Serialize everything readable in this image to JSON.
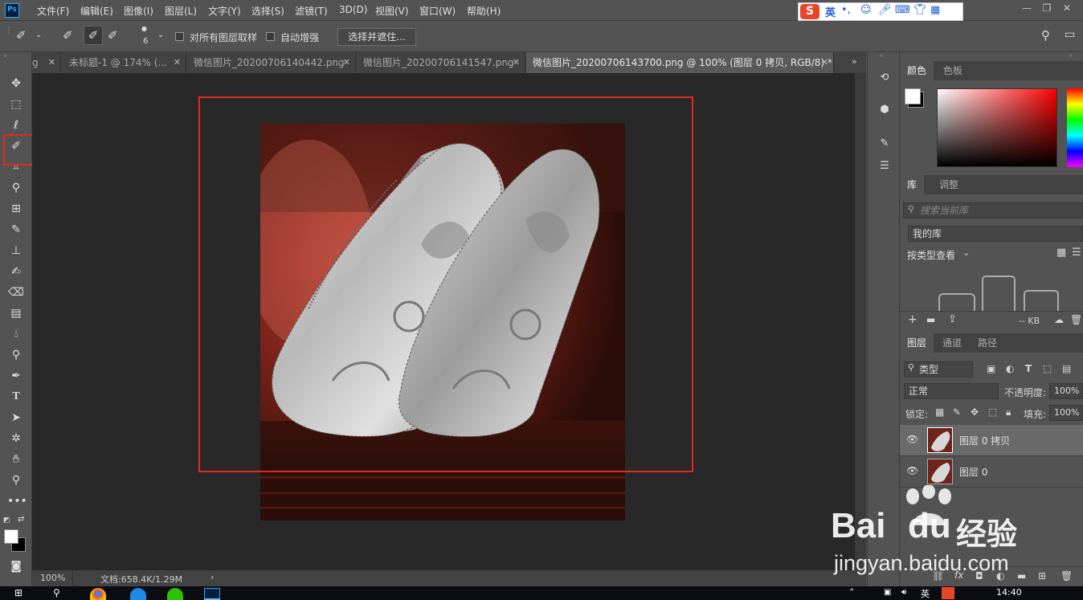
{
  "menubar": {
    "logo": "Ps",
    "items": [
      "文件(F)",
      "编辑(E)",
      "图像(I)",
      "图层(L)",
      "文字(Y)",
      "选择(S)",
      "滤镜(T)",
      "3D(D)",
      "视图(V)",
      "窗口(W)",
      "帮助(H)"
    ],
    "ime": {
      "logo": "S",
      "lang": "英",
      "punct": "•,"
    }
  },
  "options": {
    "brush_size": "6",
    "sample_all_layers": "对所有图层取样",
    "auto_enhance": "自动增强",
    "select_and_mask": "选择并遮住..."
  },
  "tabs": [
    {
      "label": "g",
      "active": false
    },
    {
      "label": "未标题-1 @ 174% (...",
      "active": false
    },
    {
      "label": "微信图片_20200706140442.png",
      "active": false
    },
    {
      "label": "微信图片_20200706141547.png",
      "active": false
    },
    {
      "label": "微信图片_20200706143700.png @ 100% (图层 0 拷贝, RGB/8) *",
      "active": true
    }
  ],
  "status": {
    "zoom": "100%",
    "doc": "文档:658.4K/1.29M"
  },
  "panels": {
    "color_tabs": [
      "颜色",
      "色板"
    ],
    "library_tabs": [
      "库",
      "调整"
    ],
    "library_search_placeholder": "搜索当前库",
    "my_library": "我的库",
    "view_by_type": "按类型查看",
    "library_size": "-- KB",
    "layer_tabs": [
      "图层",
      "通道",
      "路径"
    ],
    "filter_kind": "类型",
    "blend_mode": "正常",
    "opacity_label": "不透明度:",
    "opacity_value": "100%",
    "lock_label": "锁定:",
    "fill_label": "填充:",
    "fill_value": "100%",
    "layers": [
      {
        "name": "图层 0 拷贝",
        "selected": true
      },
      {
        "name": "图层 0",
        "selected": false
      }
    ]
  },
  "taskbar": {
    "time": "14:40",
    "ime": "英"
  },
  "watermark": {
    "brand": "Bai",
    "brand2": "du",
    "cn": "经验",
    "url": "jingyan.baidu.com"
  },
  "colors": {
    "highlight_red": "#e02a1e",
    "ps_blue": "#31a8ff"
  }
}
